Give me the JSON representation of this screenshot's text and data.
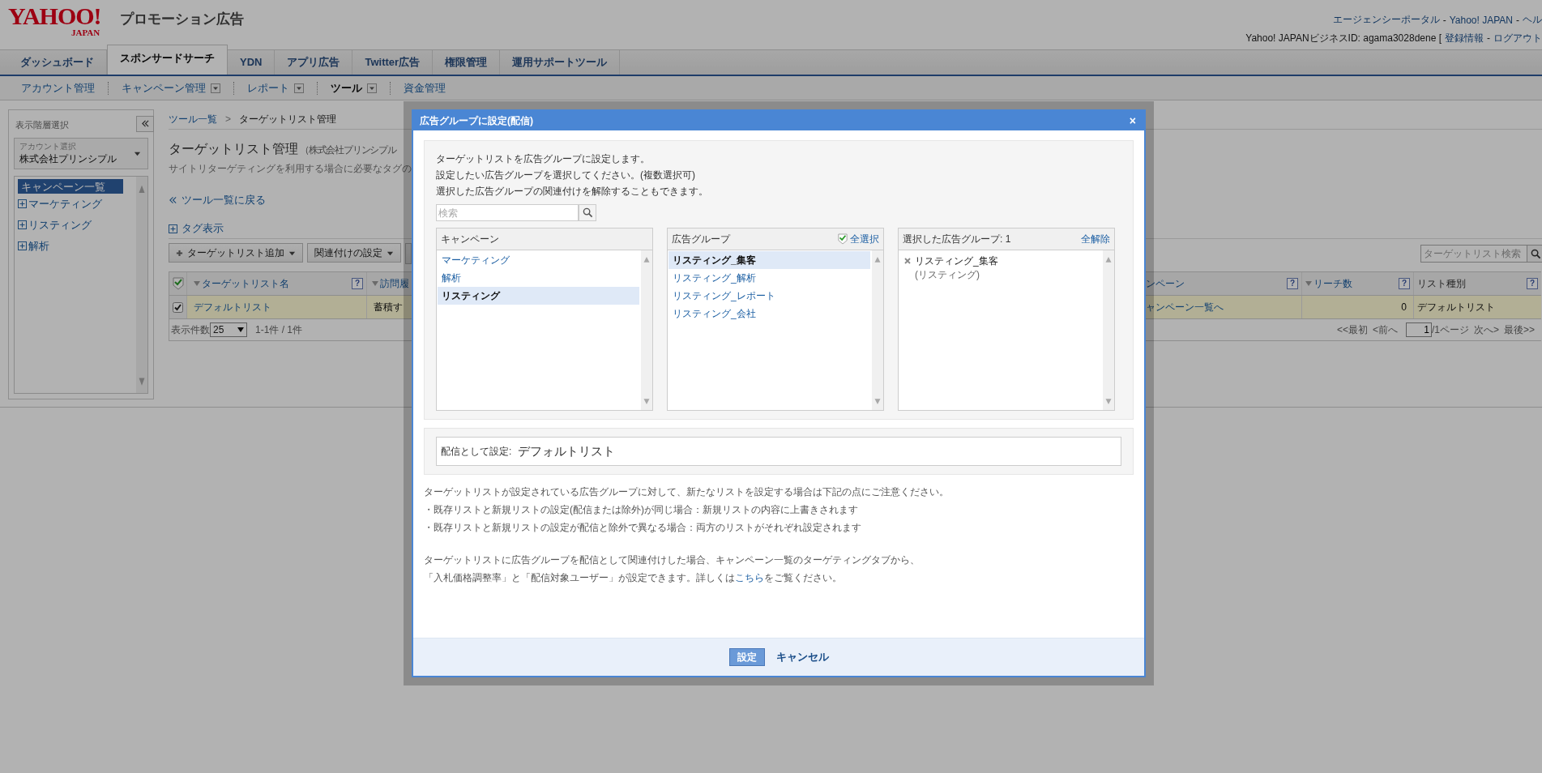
{
  "header": {
    "logo": {
      "main": "YAHOO!",
      "sub": "JAPAN"
    },
    "product": "プロモーション広告",
    "top_links": [
      {
        "text": "エージェンシーポータル",
        "kind": "link"
      },
      {
        "text": "-",
        "kind": "separator"
      },
      {
        "text": "Yahoo! JAPAN",
        "kind": "link"
      },
      {
        "text": "-",
        "kind": "separator"
      },
      {
        "text": "ヘル",
        "kind": "link"
      }
    ],
    "account_line": [
      {
        "text": "Yahoo! JAPANビジネスID: agama3028dene [",
        "kind": "text"
      },
      {
        "text": "登録情報",
        "kind": "link"
      },
      {
        "text": "-",
        "kind": "separator"
      },
      {
        "text": "ログアウト",
        "kind": "link"
      }
    ]
  },
  "tabs": [
    {
      "label": "ダッシュボード",
      "selected": false
    },
    {
      "label": "スポンサードサーチ",
      "selected": true
    },
    {
      "label": "YDN",
      "selected": false
    },
    {
      "label": "アプリ広告",
      "selected": false
    },
    {
      "label": "Twitter広告",
      "selected": false
    },
    {
      "label": "権限管理",
      "selected": false
    },
    {
      "label": "運用サポートツール",
      "selected": false
    }
  ],
  "subnav": [
    {
      "label": "アカウント管理",
      "dropdown": false,
      "selected": false
    },
    {
      "label": "キャンペーン管理",
      "dropdown": true,
      "selected": false
    },
    {
      "label": "レポート",
      "dropdown": true,
      "selected": false
    },
    {
      "label": "ツール",
      "dropdown": true,
      "selected": true
    },
    {
      "label": "資金管理",
      "dropdown": false,
      "selected": false
    }
  ],
  "sidebar": {
    "title": "表示階層選択",
    "account_select": {
      "label": "アカウント選択",
      "value": "株式会社プリンシプル"
    },
    "tree": {
      "label": "キャンペーン一覧",
      "selected": true,
      "children": [
        {
          "label": "マーケティング",
          "expanded": false
        },
        {
          "label": "リスティング",
          "expanded": false
        },
        {
          "label": "解析",
          "expanded": false
        }
      ]
    }
  },
  "main": {
    "breadcrumb": [
      {
        "label": "ツール一覧",
        "kind": "link"
      },
      {
        "label": ">",
        "kind": "separator"
      },
      {
        "label": "ターゲットリスト管理",
        "kind": "current"
      }
    ],
    "title": "ターゲットリスト管理",
    "title_note": "（株式会社プリンシプル",
    "subtitle": "サイトリターゲティングを利用する場合に必要なタグの",
    "back_link": "ツール一覧に戻る",
    "tag_toggle": {
      "label": "タグ表示",
      "expanded": false
    },
    "toolbar": [
      {
        "label": "ターゲットリスト追加",
        "kind": "add"
      },
      {
        "label": "関連付けの設定",
        "kind": "plain"
      }
    ],
    "search": {
      "placeholder": "ターゲットリスト検索"
    },
    "table": {
      "header_checked": true,
      "columns": [
        {
          "label": "ターゲットリスト名",
          "sortable": true,
          "help": "?"
        },
        {
          "label": "訪問履",
          "sortable": true
        },
        {
          "label": "ンペーン",
          "sortable": false,
          "help": "?"
        },
        {
          "label": "リーチ数",
          "sortable": true,
          "help": "?"
        },
        {
          "label": "リスト種別",
          "sortable": false,
          "help": "?"
        }
      ],
      "rows": [
        {
          "checked": true,
          "cells": [
            {
              "text": "デフォルトリスト",
              "kind": "link"
            },
            {
              "text": "蓄積す",
              "kind": "text"
            },
            {
              "text": "ャンペーン一覧へ",
              "kind": "link"
            },
            {
              "text": "0",
              "kind": "number"
            },
            {
              "text": "デフォルトリスト",
              "kind": "text"
            }
          ]
        }
      ],
      "footer": {
        "per_page_label": "表示件数",
        "per_page": "25",
        "range": "1-1件 / 1件",
        "first": "<<最初",
        "prev": "<前へ",
        "page": "1",
        "total": "/1ページ",
        "next": "次へ>",
        "last": "最後>>"
      }
    }
  },
  "modal": {
    "title": "広告グループに設定(配信)",
    "close": "×",
    "intro": [
      "ターゲットリストを広告グループに設定します。",
      "設定したい広告グループを選択してください。(複数選択可)",
      "選択した広告グループの関連付けを解除することもできます。"
    ],
    "search": {
      "placeholder": "検索"
    },
    "campaigns": {
      "title": "キャンペーン",
      "items": [
        {
          "label": "マーケティング",
          "selected": false
        },
        {
          "label": "解析",
          "selected": false
        },
        {
          "label": "リスティング",
          "selected": true
        }
      ]
    },
    "ad_groups": {
      "title": "広告グループ",
      "select_all": {
        "label": "全選択",
        "checked": true
      },
      "items": [
        {
          "label": "リスティング_集客",
          "selected": true
        },
        {
          "label": "リスティング_解析",
          "selected": false
        },
        {
          "label": "リスティング_レポート",
          "selected": false
        },
        {
          "label": "リスティング_会社",
          "selected": false
        }
      ]
    },
    "chosen": {
      "title": "選択した広告グループ:",
      "count": "1",
      "clear": "全解除",
      "items": [
        {
          "name": "リスティング_集客",
          "campaign": "(リスティング)"
        }
      ]
    },
    "assign": {
      "label": "配信として設定:",
      "value": "デフォルトリスト"
    },
    "notes": [
      [
        {
          "text": "ターゲットリストが設定されている広告グループに対して、新たなリストを設定する場合は下記の点にご注意ください。"
        },
        {
          "text": "・既存リストと新規リストの設定(配信または除外)が同じ場合：新規リストの内容に上書きされます"
        },
        {
          "text": "・既存リストと新規リストの設定が配信と除外で異なる場合：両方のリストがそれぞれ設定されます"
        }
      ],
      [
        {
          "text": "ターゲットリストに広告グループを配信として関連付けした場合、キャンペーン一覧のターゲティングタブから、"
        },
        {
          "text": "「入札価格調整率」と「配信対象ユーザー」が設定できます。詳しくは",
          "link": "こちら",
          "after": "をご覧ください。"
        }
      ]
    ],
    "buttons": {
      "ok": "設定",
      "cancel": "キャンセル"
    }
  }
}
